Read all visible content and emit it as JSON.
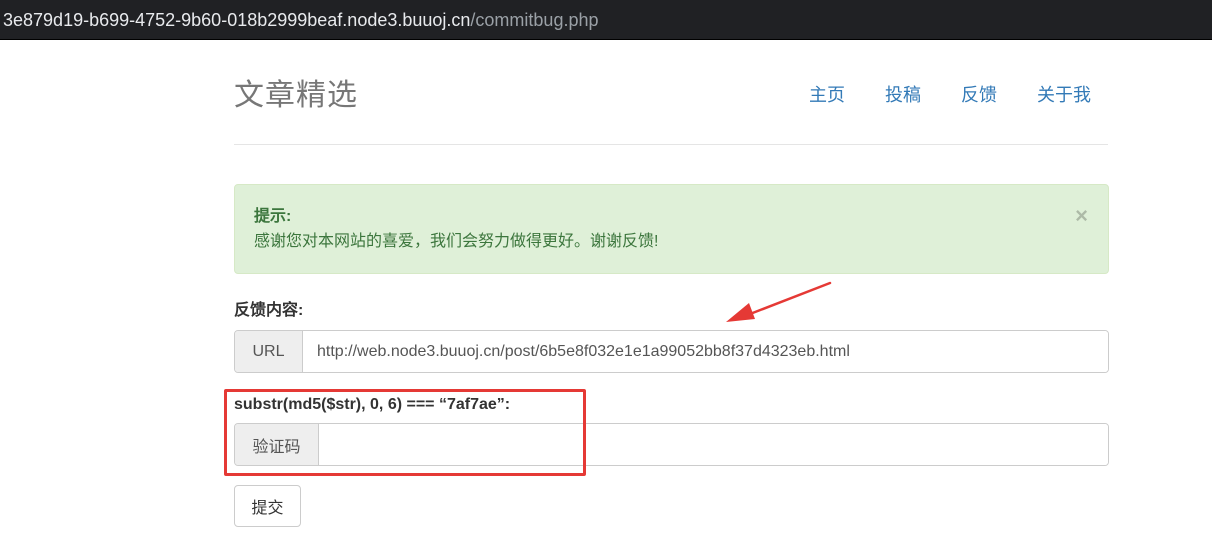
{
  "browser": {
    "url_host": "3e879d19-b699-4752-9b60-018b2999beaf.node3.buuoj.cn",
    "url_path": "/commitbug.php"
  },
  "header": {
    "brand": "文章精选",
    "nav": [
      "主页",
      "投稿",
      "反馈",
      "关于我"
    ]
  },
  "alert": {
    "title": "提示:",
    "message": "感谢您对本网站的喜爱，我们会努力做得更好。谢谢反馈!",
    "close": "×"
  },
  "form": {
    "feedback_label": "反馈内容:",
    "url_addon": "URL",
    "url_value": "http://web.node3.buuoj.cn/post/6b5e8f032e1e1a99052bb8f37d4323eb.html",
    "hash_label": "substr(md5($str), 0, 6) === “7af7ae”:",
    "code_addon": "验证码",
    "code_value": "",
    "submit_label": "提交"
  },
  "annotations": {
    "color": "#e53935"
  }
}
